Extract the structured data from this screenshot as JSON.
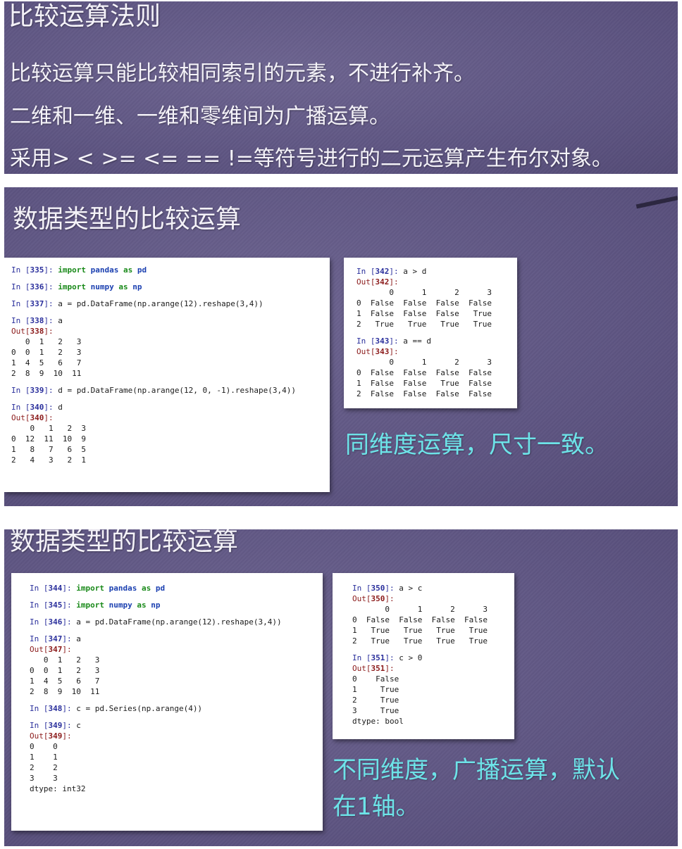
{
  "slide1": {
    "title": "比较运算法则",
    "rules": [
      "比较运算只能比较相同索引的元素，不进行补齐。",
      "二维和一维、一维和零维间为广播运算。",
      "采用> < >= <= == !=等符号进行的二元运算产生布尔对象。"
    ]
  },
  "slide2": {
    "title": "数据类型的比较运算",
    "left": {
      "in335": "335",
      "stmt_import_pandas": "import pandas as pd",
      "in336": "336",
      "stmt_import_numpy": "import numpy as np",
      "in337": "337",
      "code337": "a = pd.DataFrame(np.arange(12).reshape(3,4))",
      "in338": "338",
      "code338": "a",
      "out338": "338",
      "table338": "   0  1   2   3\n0  0  1   2   3\n1  4  5   6   7\n2  8  9  10  11",
      "in339": "339",
      "code339": "d = pd.DataFrame(np.arange(12, 0, -1).reshape(3,4))",
      "in340": "340",
      "code340": "d",
      "out340": "340",
      "table340": "    0   1   2  3\n0  12  11  10  9\n1   8   7   6  5\n2   4   3   2  1"
    },
    "right": {
      "in342": "342",
      "code342": "a > d",
      "out342": "342",
      "table342": "       0      1      2      3\n0  False  False  False  False\n1  False  False  False   True\n2   True   True   True   True",
      "in343": "343",
      "code343": "a == d",
      "out343": "343",
      "table343": "       0      1      2      3\n0  False  False  False  False\n1  False  False   True  False\n2  False  False  False  False"
    },
    "note": "同维度运算，尺寸一致。"
  },
  "slide3": {
    "title": "数据类型的比较运算",
    "left": {
      "in344": "344",
      "stmt_import_pandas": "import pandas as pd",
      "in345": "345",
      "stmt_import_numpy": "import numpy as np",
      "in346": "346",
      "code346": "a = pd.DataFrame(np.arange(12).reshape(3,4))",
      "in347": "347",
      "code347": "a",
      "out347": "347",
      "table347": "   0  1   2   3\n0  0  1   2   3\n1  4  5   6   7\n2  8  9  10  11",
      "in348": "348",
      "code348": "c = pd.Series(np.arange(4))",
      "in349": "349",
      "code349": "c",
      "out349": "349",
      "table349": "0    0\n1    1\n2    2\n3    3\ndtype: int32"
    },
    "right": {
      "in350": "350",
      "code350": "a > c",
      "out350": "350",
      "table350": "       0      1      2      3\n0  False  False  False  False\n1   True   True   True   True\n2   True   True   True   True",
      "in351": "351",
      "code351": "c > 0",
      "out351": "351",
      "table351": "0    False\n1     True\n2     True\n3     True\ndtype: bool"
    },
    "note_line1": "不同维度，广播运算，默认",
    "note_line2": "在1轴。"
  }
}
